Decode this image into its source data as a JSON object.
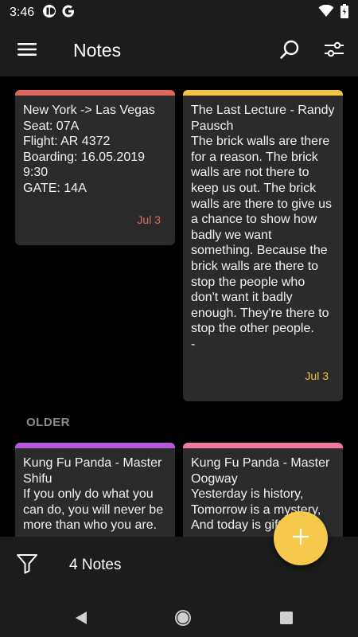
{
  "status_bar": {
    "time": "3:46",
    "icons": [
      "ad-blocker-icon",
      "google-icon",
      "wifi-icon",
      "battery-icon"
    ]
  },
  "app_bar": {
    "title": "Notes",
    "icons": [
      "menu-icon",
      "search-icon",
      "tune-icon"
    ]
  },
  "notes": [
    {
      "text": "New York -> Las Vegas\nSeat: 07A\nFlight: AR 4372\nBoarding: 16.05.2019 9:30\nGATE: 14A",
      "date": "Jul 3",
      "color": "#e0665c",
      "date_color": "#e0665c"
    },
    {
      "text": "The Last Lecture - Randy Pausch\nThe brick walls are there for a reason. The brick walls are not there to keep us out. The brick walls are there to give us a chance to show how badly we want something. Because the brick walls are there to stop the people who don't want it badly enough. They're there to stop the other people.\n-",
      "date": "Jul 3",
      "color": "#f3c640",
      "date_color": "#f3c640"
    }
  ],
  "older_header": "OLDER",
  "older_notes": [
    {
      "text": "Kung Fu Panda - Master Shifu\nIf you only do what you can do, you will never be more than who you are.",
      "color": "#b45ad8"
    },
    {
      "text": "Kung Fu Panda - Master Oogway\nYesterday is history, Tomorrow is a mystery, And today is gift",
      "color": "#f07b9a"
    }
  ],
  "bottom_bar": {
    "count_label": "4 Notes",
    "icons": [
      "filter-icon"
    ]
  },
  "fab": {
    "icon": "plus-icon",
    "color": "#f6c84c"
  },
  "nav_bar": {
    "icons": [
      "back-icon",
      "home-icon",
      "recents-icon"
    ]
  }
}
